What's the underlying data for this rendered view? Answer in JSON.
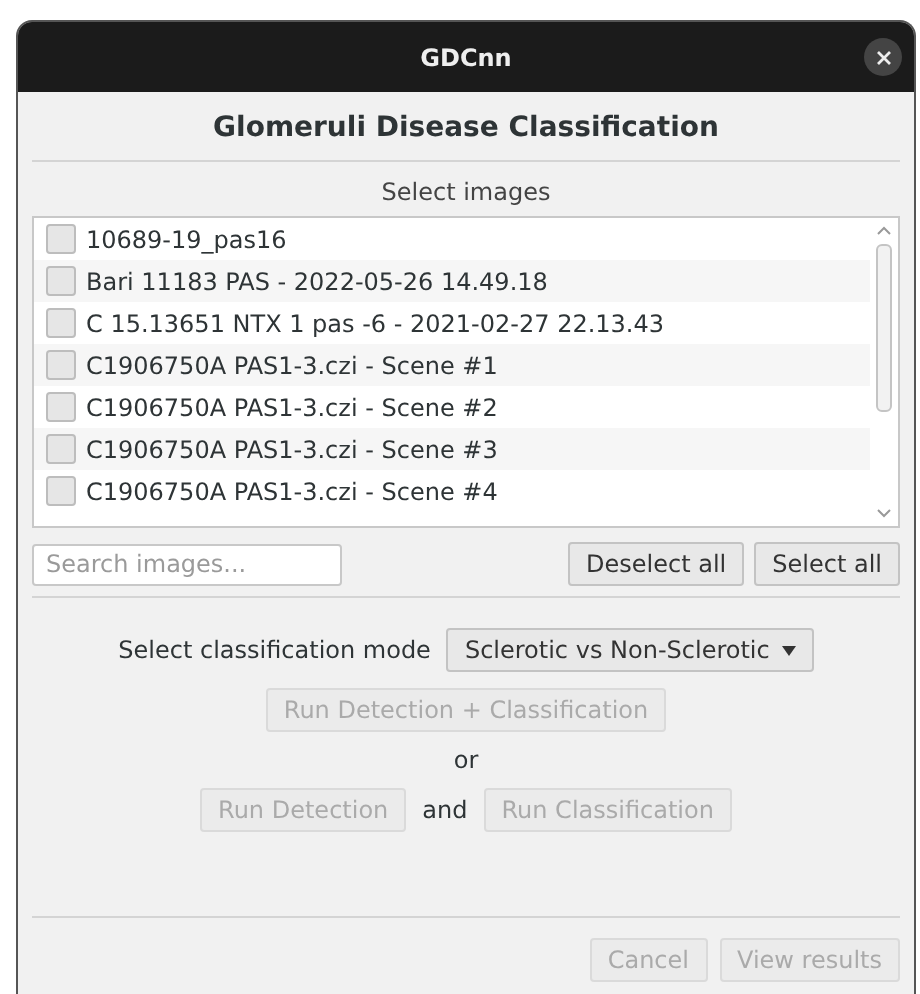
{
  "window": {
    "title": "GDCnn"
  },
  "heading": "Glomeruli Disease Classification",
  "images_label": "Select images",
  "images": [
    {
      "name": "10689-19_pas16",
      "checked": false
    },
    {
      "name": "Bari 11183 PAS - 2022-05-26 14.49.18",
      "checked": false
    },
    {
      "name": "C 15.13651 NTX 1 pas -6 - 2021-02-27 22.13.43",
      "checked": false
    },
    {
      "name": "C1906750A PAS1-3.czi - Scene #1",
      "checked": false
    },
    {
      "name": "C1906750A PAS1-3.czi - Scene #2",
      "checked": false
    },
    {
      "name": "C1906750A PAS1-3.czi - Scene #3",
      "checked": false
    },
    {
      "name": "C1906750A PAS1-3.czi - Scene #4",
      "checked": false
    }
  ],
  "search": {
    "placeholder": "Search images..."
  },
  "list_buttons": [
    {
      "label": "Deselect all",
      "disabled": false
    },
    {
      "label": "Select all",
      "disabled": false
    }
  ],
  "mode": {
    "label": "Select classification mode",
    "value": "Sclerotic vs Non-Sclerotic"
  },
  "run_all": {
    "label": "Run Detection + Classification",
    "disabled": true
  },
  "or_label": "or",
  "run_detection": {
    "label": "Run Detection",
    "disabled": true
  },
  "and_label": "and",
  "run_classification": {
    "label": "Run Classification",
    "disabled": true
  },
  "footer_buttons": [
    {
      "label": "Cancel",
      "disabled": true
    },
    {
      "label": "View results",
      "disabled": true
    }
  ]
}
